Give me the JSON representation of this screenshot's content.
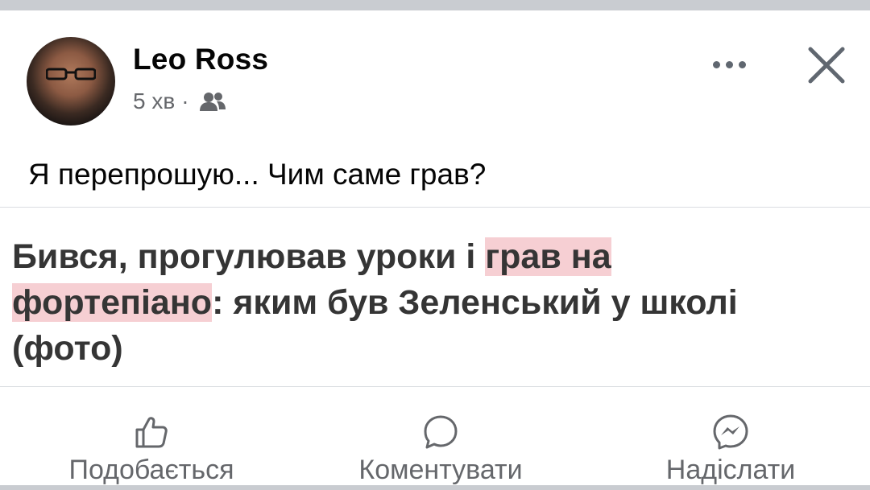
{
  "post": {
    "author_name": "Leo Ross",
    "time": "5 хв",
    "separator": "·",
    "audience_icon": "friends-icon",
    "text": "Я перепрошую... Чим саме грав?"
  },
  "header_actions": {
    "more_icon": "more-options-icon",
    "close_icon": "close-icon"
  },
  "shared_article": {
    "title_part1": "Бився, прогулював уроки і ",
    "title_highlight1": "грав на",
    "title_highlight2": "фортепіано",
    "title_part2": ": яким був Зеленський у школі (фото)",
    "highlight_color": "#f6cfd3"
  },
  "actions": [
    {
      "label": "Подобається",
      "icon": "like-icon"
    },
    {
      "label": "Коментувати",
      "icon": "comment-icon"
    },
    {
      "label": "Надіслати",
      "icon": "messenger-icon"
    }
  ]
}
